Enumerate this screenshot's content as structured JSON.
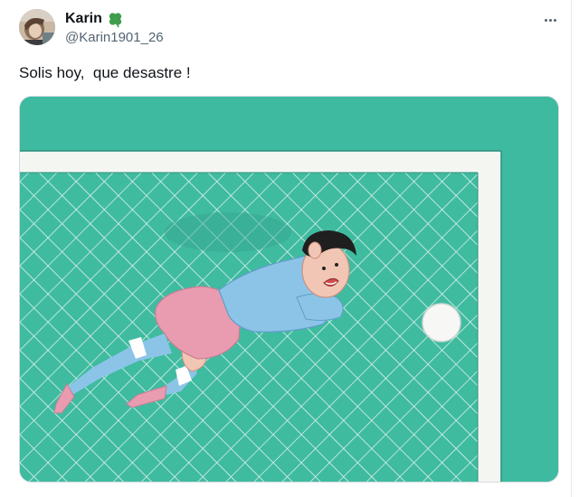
{
  "tweet": {
    "author": {
      "display_name": "Karin",
      "handle": "@Karin1901_26",
      "badge_icon": "four-leaf-clover-icon",
      "badge_color": "#3f9d4d"
    },
    "text": "Solis hoy,  que desastre !",
    "menu_icon": "more-horizontal-icon",
    "media": {
      "kind": "illustration",
      "pitch_color": "#3dba9f",
      "net_color": "#e8f6f0",
      "post_color": "#f4f6f2",
      "shirt_color": "#8cc4e8",
      "shorts_color": "#e99bb0"
    }
  }
}
